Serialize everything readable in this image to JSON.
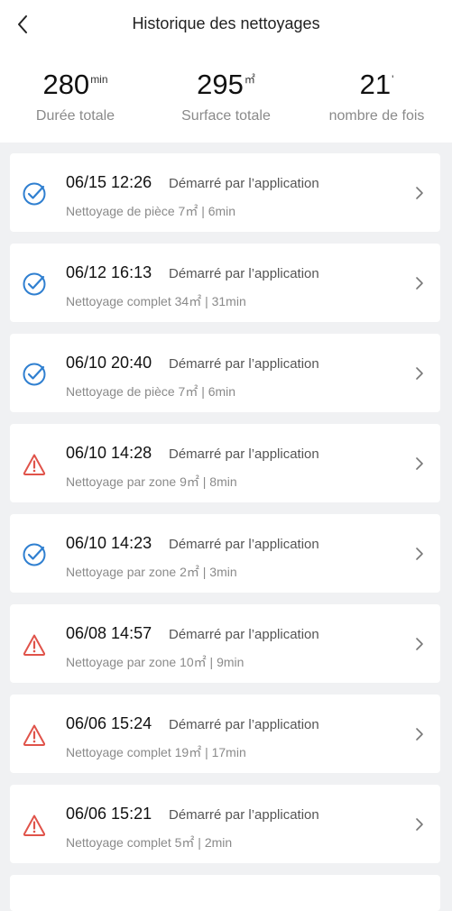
{
  "header": {
    "title": "Historique des nettoyages"
  },
  "stats": [
    {
      "value": "280",
      "unit": "min",
      "label": "Durée totale"
    },
    {
      "value": "295",
      "unit": "㎡",
      "label": "Surface totale"
    },
    {
      "value": "21",
      "unit": "'",
      "label": "nombre de fois"
    }
  ],
  "records": [
    {
      "status": "check-icon",
      "when": "06/15 12:26",
      "source": "Démarré par l’application",
      "detail": "Nettoyage de pièce 7㎡ | 6min"
    },
    {
      "status": "check-icon",
      "when": "06/12 16:13",
      "source": "Démarré par l’application",
      "detail": "Nettoyage complet 34㎡ | 31min"
    },
    {
      "status": "check-icon",
      "when": "06/10 20:40",
      "source": "Démarré par l’application",
      "detail": "Nettoyage de pièce 7㎡ | 6min"
    },
    {
      "status": "warning-icon",
      "when": "06/10 14:28",
      "source": "Démarré par l’application",
      "detail": "Nettoyage par zone 9㎡ | 8min"
    },
    {
      "status": "check-icon",
      "when": "06/10 14:23",
      "source": "Démarré par l’application",
      "detail": "Nettoyage par zone 2㎡ | 3min"
    },
    {
      "status": "warning-icon",
      "when": "06/08 14:57",
      "source": "Démarré par l’application",
      "detail": "Nettoyage par zone 10㎡ | 9min"
    },
    {
      "status": "warning-icon",
      "when": "06/06 15:24",
      "source": "Démarré par l’application",
      "detail": "Nettoyage complet 19㎡ | 17min"
    },
    {
      "status": "warning-icon",
      "when": "06/06 15:21",
      "source": "Démarré par l’application",
      "detail": "Nettoyage complet 5㎡ | 2min"
    }
  ],
  "colors": {
    "success": "#2f7fd0",
    "warning": "#e0534a"
  }
}
